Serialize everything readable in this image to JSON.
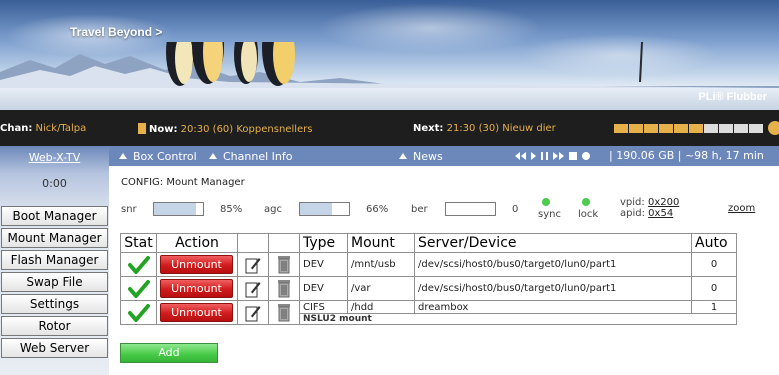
{
  "banner": {
    "tagline": "Travel Beyond >",
    "brand": "PLi® Flubber"
  },
  "infobar": {
    "chan_label": "Chan:",
    "chan_value": "Nick/Talpa",
    "now_label": "Now:",
    "now_value": "20:30 (60) Koppensnellers",
    "next_label": "Next:",
    "next_value": "21:30 (30) Nieuw dier",
    "progress": {
      "filled": 6,
      "total": 10
    },
    "accent_color": "#e6b04a"
  },
  "sidebar": {
    "title": "Web-X-TV",
    "time": "0:00",
    "items": [
      {
        "label": "Boot Manager"
      },
      {
        "label": "Mount Manager"
      },
      {
        "label": "Flash Manager"
      },
      {
        "label": "Swap File"
      },
      {
        "label": "Settings"
      },
      {
        "label": "Rotor"
      },
      {
        "label": "Web Server"
      }
    ]
  },
  "topnav": {
    "box_control": "Box Control",
    "channel_info": "Channel Info",
    "news": "News",
    "disk_status": "| 190.06 GB | ~98 h, 17 min"
  },
  "content": {
    "title": "CONFIG: Mount Manager",
    "snr_label": "snr",
    "snr_value": "85%",
    "snr_fraction": 0.85,
    "agc_label": "agc",
    "agc_value": "66%",
    "agc_fraction": 0.66,
    "ber_label": "ber",
    "ber_value": "0",
    "ber_fraction": 0,
    "sync_label": "sync",
    "lock_label": "lock",
    "vpid_label": "vpid:",
    "vpid_value": "0x200",
    "apid_label": "apid:",
    "apid_value": "0x54",
    "zoom_label": "zoom",
    "table": {
      "headers": {
        "stat": "Stat",
        "action": "Action",
        "type": "Type",
        "mount": "Mount",
        "server": "Server/Device",
        "auto": "Auto"
      },
      "unmount_label": "Unmount",
      "rows": [
        {
          "type": "DEV",
          "mount": "/mnt/usb",
          "server": "/dev/scsi/host0/bus0/target0/lun0/part1",
          "auto": "0"
        },
        {
          "type": "DEV",
          "mount": "/var",
          "server": "/dev/scsi/host0/bus0/target0/lun0/part1",
          "auto": "0"
        },
        {
          "type": "CIFS",
          "mount": "/hdd",
          "server": "dreambox",
          "auto": "1",
          "note": "NSLU2 mount"
        }
      ]
    },
    "add_label": "Add"
  }
}
